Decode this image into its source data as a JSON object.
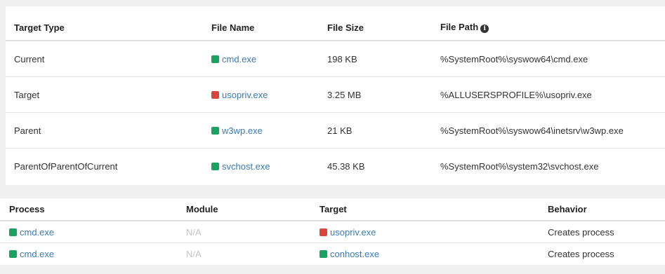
{
  "colors": {
    "clean": "#1aa260",
    "malicious": "#d9473a",
    "link": "#3a7ab5"
  },
  "targets": {
    "headers": {
      "target_type": "Target Type",
      "file_name": "File Name",
      "file_size": "File Size",
      "file_path": "File Path"
    },
    "info_icon": "info-circle-icon",
    "rows": [
      {
        "type": "Current",
        "name": "cmd.exe",
        "status": "clean",
        "size": "198 KB",
        "path": "%SystemRoot%\\syswow64\\cmd.exe"
      },
      {
        "type": "Target",
        "name": "usopriv.exe",
        "status": "malicious",
        "size": "3.25 MB",
        "path": "%ALLUSERSPROFILE%\\usopriv.exe"
      },
      {
        "type": "Parent",
        "name": "w3wp.exe",
        "status": "clean",
        "size": "21 KB",
        "path": "%SystemRoot%\\syswow64\\inetsrv\\w3wp.exe"
      },
      {
        "type": "ParentOfParentOfCurrent",
        "name": "svchost.exe",
        "status": "clean",
        "size": "45.38 KB",
        "path": "%SystemRoot%\\system32\\svchost.exe"
      }
    ]
  },
  "behaviors": {
    "headers": {
      "process": "Process",
      "module": "Module",
      "target": "Target",
      "behavior": "Behavior"
    },
    "rows": [
      {
        "process": "cmd.exe",
        "process_status": "clean",
        "module": "N/A",
        "target": "usopriv.exe",
        "target_status": "malicious",
        "behavior": "Creates process"
      },
      {
        "process": "cmd.exe",
        "process_status": "clean",
        "module": "N/A",
        "target": "conhost.exe",
        "target_status": "clean",
        "behavior": "Creates process"
      }
    ]
  }
}
